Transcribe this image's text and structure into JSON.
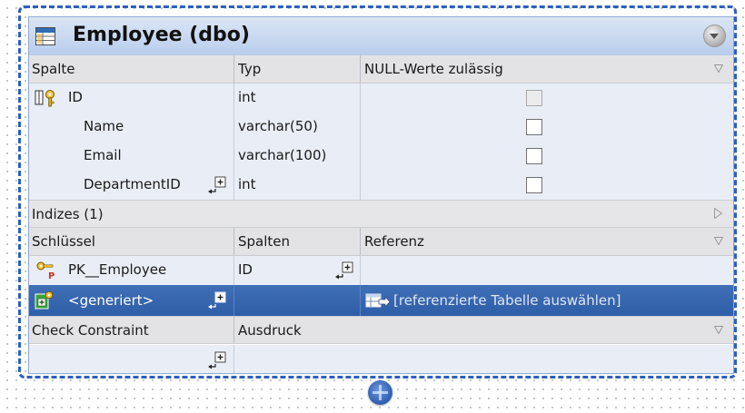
{
  "window": {
    "title": "Employee (dbo)",
    "icons": {
      "table": "table-icon",
      "collapse": "collapse-circle-icon",
      "add": "add-circle-icon"
    }
  },
  "columns_section": {
    "headers": {
      "column": "Spalte",
      "type": "Typ",
      "nullable": "NULL-Werte zulässig"
    },
    "rows": [
      {
        "name": "ID",
        "type": "int",
        "nullable": false,
        "key_icon": "primary-key-icon"
      },
      {
        "name": "Name",
        "type": "varchar(50)",
        "nullable": false
      },
      {
        "name": "Email",
        "type": "varchar(100)",
        "nullable": false
      },
      {
        "name": "DepartmentID",
        "type": "int",
        "nullable": false,
        "expand_icon": "expand-plus-icon"
      }
    ]
  },
  "indexes_section": {
    "title": "Indizes (1)",
    "headers": {
      "key": "Schlüssel",
      "columns": "Spalten",
      "reference": "Referenz"
    },
    "rows": [
      {
        "key": "PK__Employee",
        "columns": "ID",
        "reference": "",
        "icon": "primary-key-icon"
      },
      {
        "key": "<generiert>",
        "columns": "",
        "reference": "[referenzierte Tabelle auswählen]",
        "icon": "generated-key-icon",
        "selected": true
      }
    ]
  },
  "check_section": {
    "headers": {
      "constraint": "Check Constraint",
      "expression": "Ausdruck"
    }
  },
  "colors": {
    "frame_border": "#2d5fbf",
    "title_bar": "#c6d6f0",
    "selection": "#3567b0",
    "row_background": "#e9eef6"
  }
}
